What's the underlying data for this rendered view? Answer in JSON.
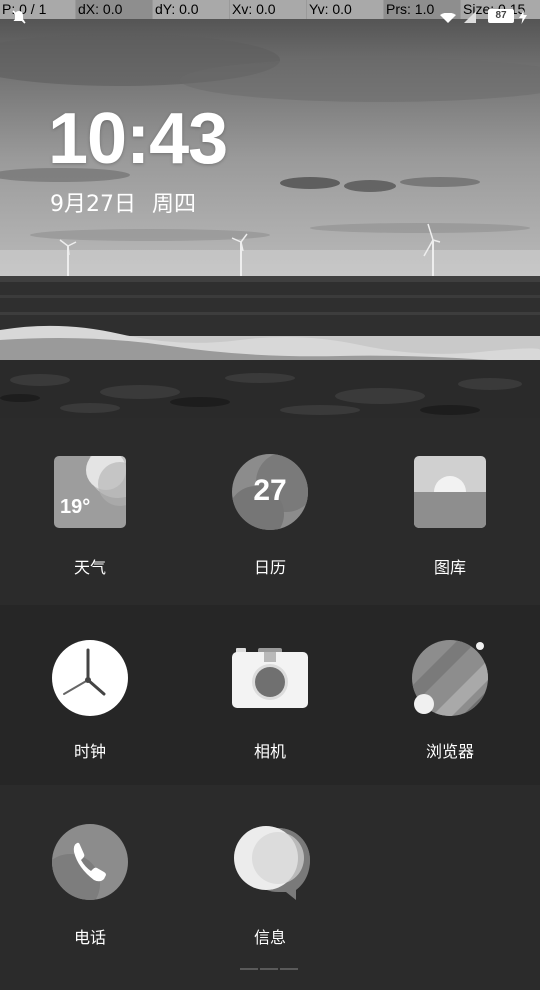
{
  "debug_bar": {
    "pointer": "P: 0 / 1",
    "dx": "dX: 0.0",
    "dy": "dY: 0.0",
    "xv": "Xv: 0.0",
    "yv": "Yv: 0.0",
    "prs": "Prs: 1.0",
    "size": "Size: 0.15"
  },
  "status_bar": {
    "battery": "87",
    "icons": [
      "notification-muted-icon",
      "wifi-icon",
      "sim-icon",
      "battery-icon",
      "charging-icon"
    ]
  },
  "clock": {
    "time": "10:43",
    "date": "9月27日",
    "weekday": "周四"
  },
  "apps": [
    {
      "name": "天气",
      "icon": "weather-icon",
      "badge": "19°"
    },
    {
      "name": "日历",
      "icon": "calendar-icon",
      "badge": "27"
    },
    {
      "name": "图库",
      "icon": "gallery-icon"
    },
    {
      "name": "时钟",
      "icon": "clock-icon"
    },
    {
      "name": "相机",
      "icon": "camera-icon"
    },
    {
      "name": "浏览器",
      "icon": "browser-icon"
    },
    {
      "name": "电话",
      "icon": "phone-icon"
    },
    {
      "name": "信息",
      "icon": "messages-icon"
    }
  ],
  "colors": {
    "background": "#2b2b2b",
    "debug_bar": "#a9a9a9"
  }
}
